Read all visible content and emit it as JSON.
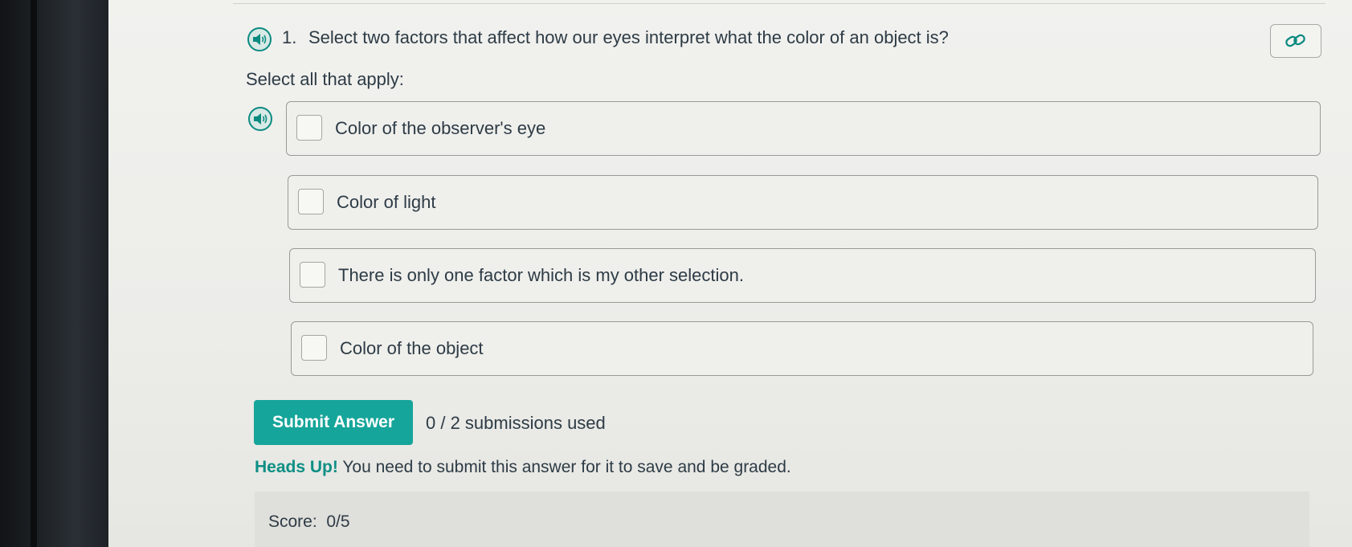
{
  "question": {
    "number": "1.",
    "text": "Select two factors that affect how our eyes interpret what the color of an object is?",
    "instruction": "Select all that apply:"
  },
  "options": [
    {
      "label": "Color of the observer's eye",
      "checked": false
    },
    {
      "label": "Color of light",
      "checked": false
    },
    {
      "label": "There is only one factor which is my other selection.",
      "checked": false
    },
    {
      "label": "Color of the object",
      "checked": false
    }
  ],
  "actions": {
    "submit_label": "Submit Answer",
    "submissions": "0 / 2 submissions used"
  },
  "notice": {
    "title": "Heads Up!",
    "text": "You need to submit this answer for it to save and be graded."
  },
  "score": {
    "label": "Score:",
    "value": "0/5"
  },
  "icons": {
    "speaker": "speaker-icon",
    "link": "link-icon"
  },
  "colors": {
    "accent": "#16a59a",
    "heads_up": "#0e8f85",
    "text": "#2d3b45"
  }
}
